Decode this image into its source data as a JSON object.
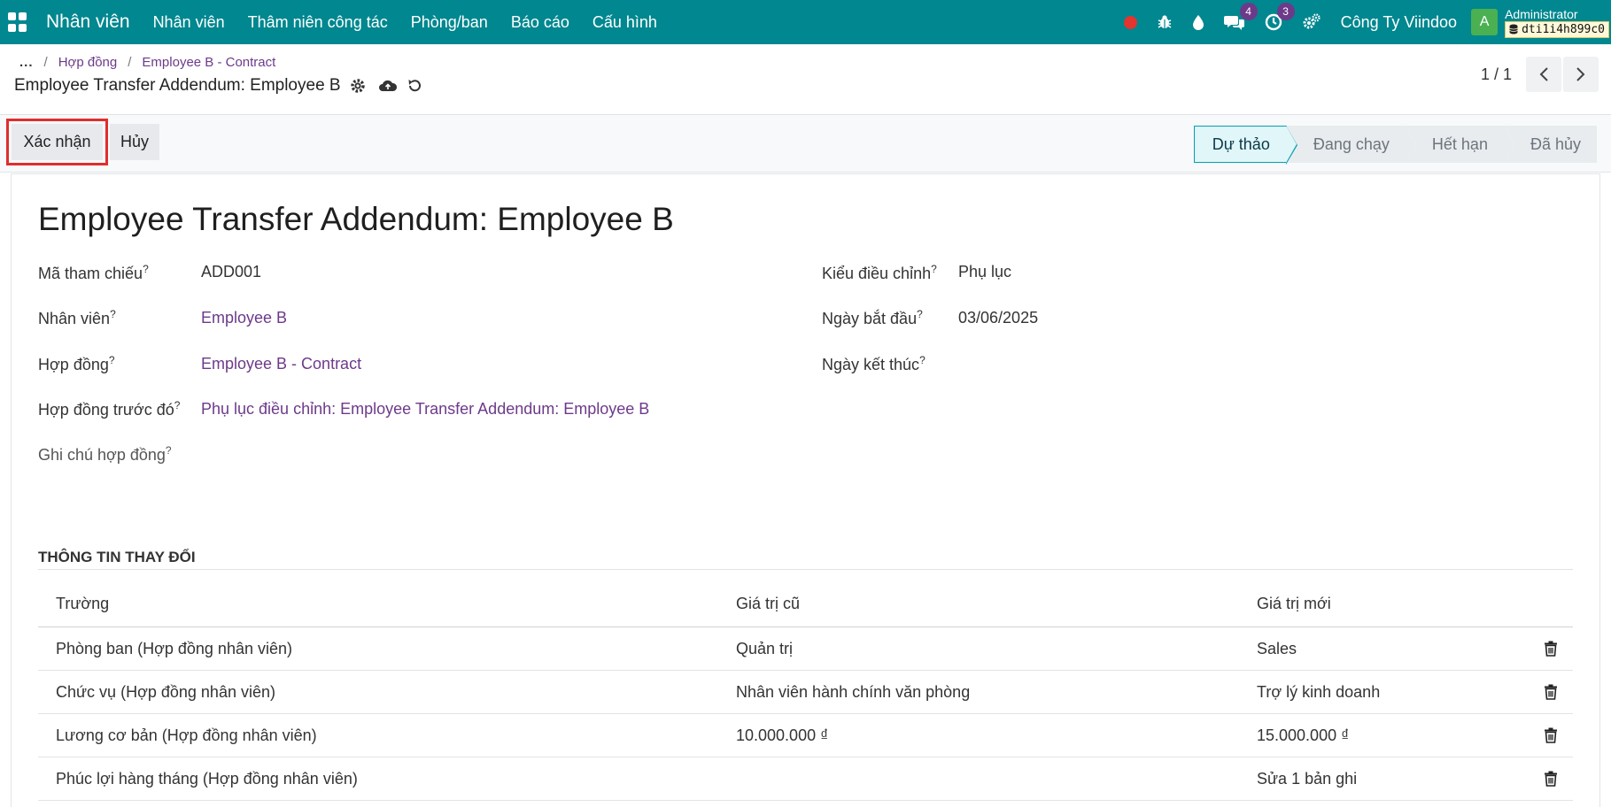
{
  "navbar": {
    "app_name": "Nhân viên",
    "menu": [
      "Nhân viên",
      "Thâm niên công tác",
      "Phòng/ban",
      "Báo cáo",
      "Cấu hình"
    ],
    "messages_count": "4",
    "activities_count": "3",
    "company": "Công Ty Viindoo",
    "avatar_letter": "A",
    "user": "Administrator",
    "database": "dti1i4h899c0"
  },
  "breadcrumb": {
    "dots": "...",
    "items": [
      "Hợp đồng",
      "Employee B - Contract"
    ]
  },
  "record": {
    "title": "Employee Transfer Addendum: Employee B"
  },
  "pager": {
    "value": "1 / 1"
  },
  "actions": {
    "confirm": "Xác nhận",
    "cancel": "Hủy"
  },
  "stages": [
    "Dự thảo",
    "Đang chạy",
    "Hết hạn",
    "Đã hủy"
  ],
  "form": {
    "title": "Employee Transfer Addendum: Employee B",
    "left": [
      {
        "label": "Mã tham chiếu",
        "value": "ADD001"
      },
      {
        "label": "Nhân viên",
        "value": "Employee B"
      },
      {
        "label": "Hợp đồng",
        "value": "Employee B - Contract"
      },
      {
        "label": "Hợp đồng trước đó",
        "value": "Phụ lục điều chỉnh: Employee Transfer Addendum: Employee B"
      },
      {
        "label": "Ghi chú hợp đồng",
        "value": ""
      }
    ],
    "right": [
      {
        "label": "Kiểu điều chỉnh",
        "value": "Phụ lục"
      },
      {
        "label": "Ngày bắt đầu",
        "value": "03/06/2025"
      },
      {
        "label": "Ngày kết thúc",
        "value": ""
      }
    ],
    "help_mark": "?"
  },
  "changes": {
    "section_title": "THÔNG TIN THAY ĐỔI",
    "headers": [
      "Trường",
      "Giá trị cũ",
      "Giá trị mới"
    ],
    "rows": [
      {
        "field": "Phòng ban (Hợp đồng nhân viên)",
        "old": "Quản trị",
        "new": "Sales"
      },
      {
        "field": "Chức vụ (Hợp đồng nhân viên)",
        "old": "Nhân viên hành chính văn phòng",
        "new": "Trợ lý kinh doanh"
      },
      {
        "field": "Lương cơ bản (Hợp đồng nhân viên)",
        "old": "10.000.000 ₫",
        "new": "15.000.000 ₫"
      },
      {
        "field": "Phúc lợi hàng tháng (Hợp đồng nhân viên)",
        "old": "",
        "new": "Sửa 1 bản ghi"
      }
    ]
  },
  "colors": {
    "navbar": "#00878f",
    "link": "#6d3a8a",
    "active_stage": "#e1f6f8",
    "highlight": "#e02d2d"
  }
}
